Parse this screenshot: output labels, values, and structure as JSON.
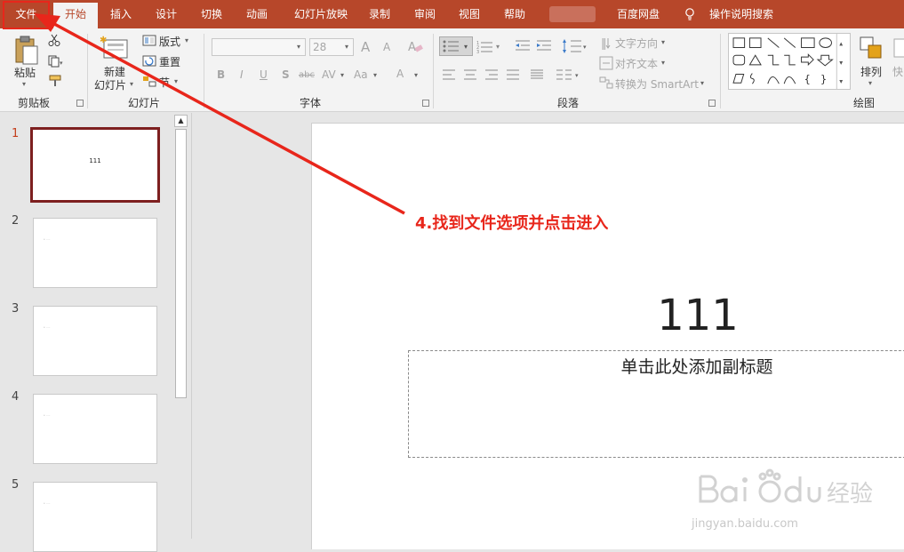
{
  "tabs": {
    "file": "文件",
    "home": "开始",
    "insert": "插入",
    "design": "设计",
    "transitions": "切换",
    "animations": "动画",
    "slideshow": "幻灯片放映",
    "record": "录制",
    "review": "审阅",
    "view": "视图",
    "help": "帮助",
    "baidu_pan": "百度网盘",
    "tell_me": "操作说明搜索"
  },
  "ribbon": {
    "clipboard": {
      "paste": "粘贴",
      "group": "剪贴板"
    },
    "slides": {
      "new_slide_1": "新建",
      "new_slide_2": "幻灯片",
      "layout": "版式",
      "reset": "重置",
      "section": "节",
      "group": "幻灯片"
    },
    "font": {
      "font_size": "28",
      "bold": "B",
      "italic": "I",
      "underline": "U",
      "shadow": "S",
      "strike": "abc",
      "spacing": "AV",
      "case": "Aa",
      "color": "A",
      "grow": "A",
      "shrink": "A",
      "group": "字体"
    },
    "paragraph": {
      "text_direction": "文字方向",
      "align_text": "对齐文本",
      "smartart": "转换为 SmartArt",
      "group": "段落"
    },
    "drawing": {
      "arrange": "排列",
      "quick": "快",
      "group": "绘图"
    }
  },
  "thumbnails": [
    {
      "num": "1",
      "title": "111",
      "selected": true
    },
    {
      "num": "2",
      "title": "",
      "selected": false
    },
    {
      "num": "3",
      "title": "",
      "selected": false
    },
    {
      "num": "4",
      "title": "",
      "selected": false
    },
    {
      "num": "5",
      "title": "",
      "selected": false
    }
  ],
  "slide": {
    "title": "111",
    "subtitle": "单击此处添加副标题"
  },
  "annotation": "4.找到文件选项并点击进入",
  "watermark": {
    "url": "jingyan.baidu.com"
  },
  "colors": {
    "accent": "#b7472a",
    "annotation": "#e8261b",
    "selected_thumb": "#7d1f1f"
  }
}
